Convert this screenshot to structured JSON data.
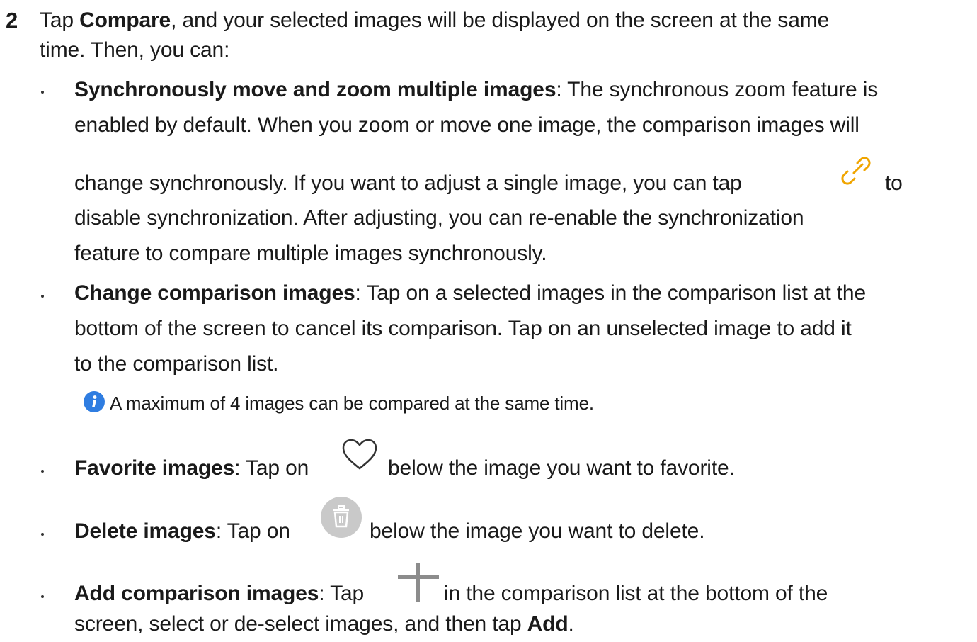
{
  "step": {
    "number": "2",
    "l1a": "Tap ",
    "l1b": "Compare",
    "l1c": ", and your selected images will be displayed on the screen at the same",
    "l2": "time. Then, you can:"
  },
  "sync": {
    "title": "Synchronously move and zoom multiple images",
    "l1": ": The synchronous zoom feature is",
    "l2": "enabled by default. When you zoom or move one image, the comparison images will",
    "l3a": "change synchronously. If you want to adjust a single image, you can tap",
    "l3b": "to",
    "l4": "disable synchronization. After adjusting, you can re-enable the synchronization",
    "l5": "feature to compare multiple images synchronously."
  },
  "change": {
    "title": "Change comparison images",
    "l1": ": Tap on a selected images in the comparison list at the",
    "l2": "bottom of the screen to cancel its comparison. Tap on an unselected image to add it",
    "l3": "to the comparison list."
  },
  "note": {
    "text": "A maximum of 4 images can be compared at the same time."
  },
  "favorite": {
    "title": "Favorite images",
    "a": ": Tap on",
    "b": "below the image you want to favorite."
  },
  "delete": {
    "title": "Delete images",
    "a": ": Tap on",
    "b": "below the image you want to delete."
  },
  "add": {
    "title": "Add comparison images",
    "a": ": Tap",
    "b": "in the comparison list at the bottom of the",
    "l2a": "screen, select or de-select images, and then tap ",
    "l2b": "Add",
    "l2c": "."
  },
  "icons": {
    "link": "link-icon",
    "heart": "heart-icon",
    "trash": "trash-icon",
    "plus": "plus-icon",
    "info": "info-icon"
  },
  "colors": {
    "link_icon": "#f0a500",
    "info_icon": "#2f7de1",
    "trash_bg": "#c9c9c9"
  }
}
